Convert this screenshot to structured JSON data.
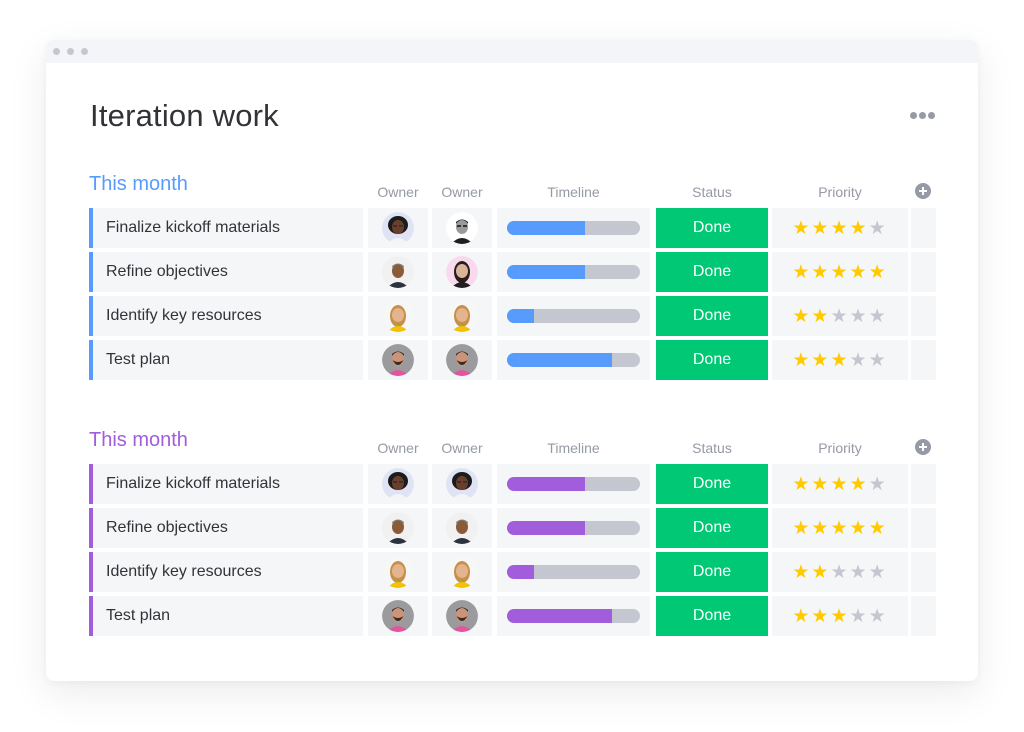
{
  "window": {
    "title": "Iteration work",
    "more_icon": "more-horizontal-icon"
  },
  "columns": {
    "owner1": "Owner",
    "owner2": "Owner",
    "timeline": "Timeline",
    "status": "Status",
    "priority": "Priority",
    "add_icon": "plus-circle-icon"
  },
  "groups": [
    {
      "title": "This month",
      "color": "#579bfc",
      "rows": [
        {
          "name": "Finalize kickoff materials",
          "owners": [
            "woman-glasses-curly-hair",
            "man-sunglasses-bw"
          ],
          "timeline_progress": 0.59,
          "status": "Done",
          "priority": 4
        },
        {
          "name": "Refine objectives",
          "owners": [
            "man-beanie-smiling",
            "woman-dark-hair-pink-bg"
          ],
          "timeline_progress": 0.59,
          "status": "Done",
          "priority": 5
        },
        {
          "name": "Identify key resources",
          "owners": [
            "woman-blonde-yellow-item",
            "woman-blonde-yellow-item"
          ],
          "timeline_progress": 0.2,
          "status": "Done",
          "priority": 2
        },
        {
          "name": "Test plan",
          "owners": [
            "man-beard-floral-shirt",
            "man-beard-floral-shirt"
          ],
          "timeline_progress": 0.79,
          "status": "Done",
          "priority": 3
        }
      ]
    },
    {
      "title": "This month",
      "color": "#a25ddc",
      "rows": [
        {
          "name": "Finalize kickoff materials",
          "owners": [
            "woman-glasses-curly-hair",
            "woman-glasses-curly-hair"
          ],
          "timeline_progress": 0.59,
          "status": "Done",
          "priority": 4
        },
        {
          "name": "Refine objectives",
          "owners": [
            "man-beanie-smiling",
            "man-beanie-smiling"
          ],
          "timeline_progress": 0.59,
          "status": "Done",
          "priority": 5
        },
        {
          "name": "Identify key resources",
          "owners": [
            "woman-blonde-yellow-item",
            "woman-blonde-yellow-item"
          ],
          "timeline_progress": 0.2,
          "status": "Done",
          "priority": 2
        },
        {
          "name": "Test plan",
          "owners": [
            "man-beard-floral-shirt",
            "man-beard-floral-shirt"
          ],
          "timeline_progress": 0.79,
          "status": "Done",
          "priority": 3
        }
      ]
    }
  ],
  "colors": {
    "status_done": "#00c875",
    "star_on": "#ffcb00",
    "star_off": "#c5c7d0",
    "track": "#c5c7d0"
  },
  "max_priority": 5
}
